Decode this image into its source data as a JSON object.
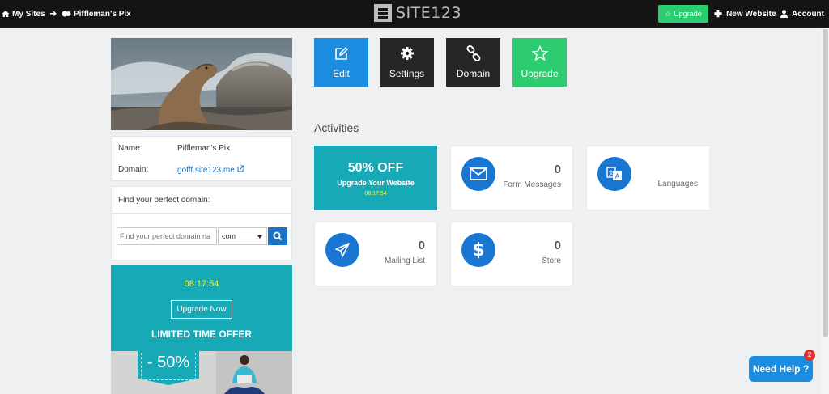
{
  "topbar": {
    "breadcrumb_home": "My Sites",
    "breadcrumb_site": "Piffleman's Pix",
    "logo": "SITE123",
    "upgrade_label": "Upgrade",
    "new_website_label": "New Website",
    "account_label": "Account"
  },
  "site_info": {
    "name_label": "Name:",
    "name_value": "Piffleman's Pix",
    "domain_label": "Domain:",
    "domain_value": "gofff.site123.me"
  },
  "domain_search": {
    "title": "Find your perfect domain:",
    "placeholder": "Find your perfect domain na",
    "tld": "com"
  },
  "offer": {
    "timer": "08:17:54",
    "button": "Upgrade Now",
    "headline": "LIMITED TIME OFFER",
    "discount": "- 50%"
  },
  "actions": [
    {
      "label": "Edit",
      "icon": "edit-icon",
      "color": "#1a8de0"
    },
    {
      "label": "Settings",
      "icon": "gear-icon",
      "color": "#262626"
    },
    {
      "label": "Domain",
      "icon": "link-icon",
      "color": "#262626"
    },
    {
      "label": "Upgrade",
      "icon": "star-icon",
      "color": "#2ecc71"
    }
  ],
  "activities": {
    "title": "Activities",
    "sale": {
      "headline": "50% OFF",
      "sub": "Upgrade Your Website",
      "timer": "08:17:54"
    },
    "form_messages": {
      "count": "0",
      "label": "Form Messages"
    },
    "languages": {
      "label": "Languages"
    },
    "mailing_list": {
      "count": "0",
      "label": "Mailing List"
    },
    "store": {
      "count": "0",
      "label": "Store"
    }
  },
  "help": {
    "label": "Need Help ?",
    "badge": "2"
  },
  "colors": {
    "accent": "#1a8de0",
    "teal": "#17a9b6",
    "green": "#2ecc71",
    "dark": "#141414"
  }
}
